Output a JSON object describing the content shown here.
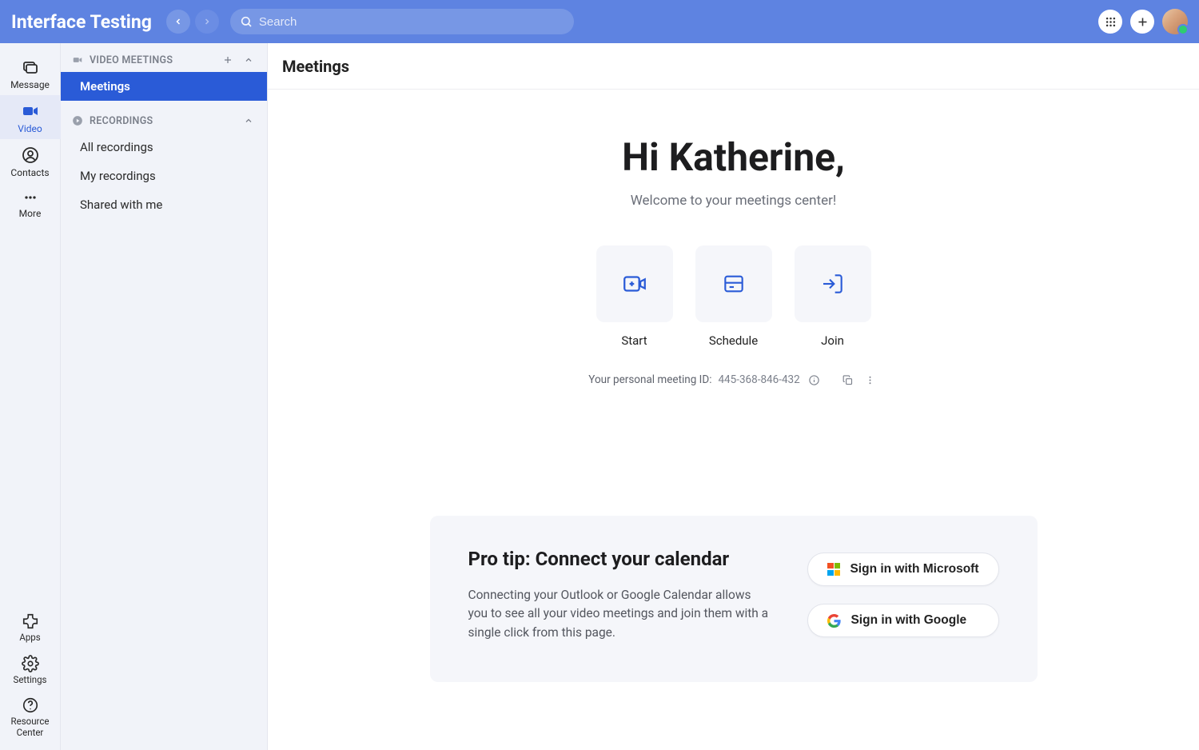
{
  "app_title": "Interface Testing",
  "search": {
    "placeholder": "Search"
  },
  "rail": {
    "message": "Message",
    "video": "Video",
    "contacts": "Contacts",
    "more": "More",
    "apps": "Apps",
    "settings": "Settings",
    "resource_center": "Resource Center"
  },
  "sidebar": {
    "video_meetings_header": "VIDEO MEETINGS",
    "meetings": "Meetings",
    "recordings_header": "RECORDINGS",
    "all_recordings": "All recordings",
    "my_recordings": "My recordings",
    "shared_with_me": "Shared with me"
  },
  "main": {
    "page_title": "Meetings",
    "greeting": "Hi Katherine,",
    "subgreeting": "Welcome to your meetings center!",
    "actions": {
      "start": "Start",
      "schedule": "Schedule",
      "join": "Join"
    },
    "pmi": {
      "label": "Your personal meeting ID:",
      "value": "445-368-846-432"
    },
    "protip": {
      "title": "Pro tip: Connect your calendar",
      "body": "Connecting your Outlook or Google Calendar allows you to see all your video meetings and join them with a single click from this page.",
      "ms_btn": "Sign in with Microsoft",
      "google_btn": "Sign in with Google"
    }
  }
}
